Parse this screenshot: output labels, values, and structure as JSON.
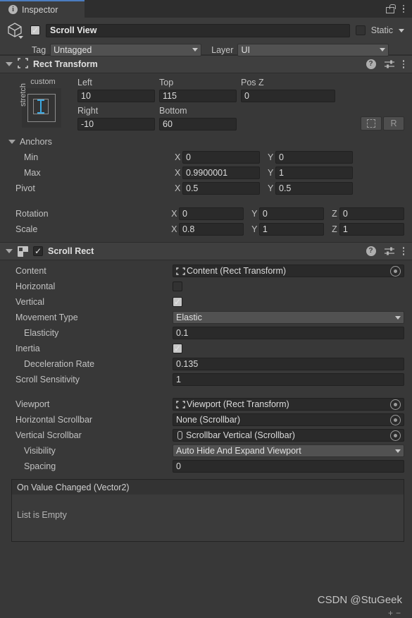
{
  "tabbar": {
    "tab_label": "Inspector",
    "info_glyph": "i",
    "lock_icon": "lock-open-icon",
    "menu_icon": "kebab-menu-icon"
  },
  "object_header": {
    "icon": "gameobject-cube-icon",
    "enabled": true,
    "name": "Scroll View",
    "static_label": "Static",
    "static_checked": false,
    "tag_label": "Tag",
    "tag_value": "Untagged",
    "layer_label": "Layer",
    "layer_value": "UI"
  },
  "rect_transform": {
    "title": "Rect Transform",
    "anchor_preset_top": "custom",
    "anchor_preset_side": "stretch",
    "columns": [
      {
        "label": "Left",
        "value": "10"
      },
      {
        "label": "Top",
        "value": "115"
      },
      {
        "label": "Pos Z",
        "value": "0"
      }
    ],
    "columns2": [
      {
        "label": "Right",
        "value": "-10"
      },
      {
        "label": "Bottom",
        "value": "60"
      }
    ],
    "blueprint_button": "blueprint-mode-icon",
    "rawedit_button": "R",
    "anchors_label": "Anchors",
    "min_label": "Min",
    "min_x": "0",
    "min_y": "0",
    "max_label": "Max",
    "max_x": "0.9900001",
    "max_y": "1",
    "pivot_label": "Pivot",
    "pivot_x": "0.5",
    "pivot_y": "0.5",
    "rotation_label": "Rotation",
    "rotation_x": "0",
    "rotation_y": "0",
    "rotation_z": "0",
    "scale_label": "Scale",
    "scale_x": "0.8",
    "scale_y": "1",
    "scale_z": "1",
    "axis_x": "X",
    "axis_y": "Y",
    "axis_z": "Z"
  },
  "scroll_rect": {
    "title": "Scroll Rect",
    "enabled": true,
    "content_label": "Content",
    "content_value": "Content (Rect Transform)",
    "horizontal_label": "Horizontal",
    "horizontal_checked": false,
    "vertical_label": "Vertical",
    "vertical_checked": true,
    "movement_type_label": "Movement Type",
    "movement_type_value": "Elastic",
    "elasticity_label": "Elasticity",
    "elasticity_value": "0.1",
    "inertia_label": "Inertia",
    "inertia_checked": true,
    "deceleration_label": "Deceleration Rate",
    "deceleration_value": "0.135",
    "sensitivity_label": "Scroll Sensitivity",
    "sensitivity_value": "1",
    "viewport_label": "Viewport",
    "viewport_value": "Viewport (Rect Transform)",
    "hscrollbar_label": "Horizontal Scrollbar",
    "hscrollbar_value": "None (Scrollbar)",
    "vscrollbar_label": "Vertical Scrollbar",
    "vscrollbar_value": "Scrollbar Vertical (Scrollbar)",
    "visibility_label": "Visibility",
    "visibility_value": "Auto Hide And Expand Viewport",
    "spacing_label": "Spacing",
    "spacing_value": "0",
    "event_header": "On Value Changed (Vector2)",
    "event_empty": "List is Empty",
    "add_button": "+",
    "remove_button": "−"
  },
  "component_icons": {
    "help": "?",
    "preset": "preset-settings-icon",
    "menu": "kebab-menu-icon"
  },
  "watermark": "CSDN @StuGeek",
  "colors": {
    "panel_bg": "#383838",
    "header_bg": "#3c3c3c",
    "field_bg": "#2a2a2a",
    "dropdown_bg": "#515151",
    "accent_blue": "#4b7dc0",
    "anchor_arrow": "#3ea8e0"
  }
}
